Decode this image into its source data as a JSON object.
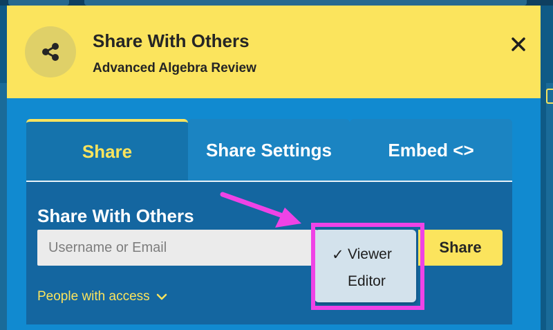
{
  "modal": {
    "title": "Share With Others",
    "subtitle": "Advanced Algebra Review",
    "header_icon": "share-icon",
    "close_icon": "close-icon"
  },
  "tabs": [
    {
      "label": "Share",
      "active": true
    },
    {
      "label": "Share Settings",
      "active": false
    },
    {
      "label": "Embed <>",
      "active": false
    }
  ],
  "panel": {
    "title": "Share With Others",
    "input_placeholder": "Username or Email",
    "share_button": "Share",
    "people_access": "People with access"
  },
  "role_dropdown": {
    "options": [
      {
        "label": "Viewer",
        "selected": true,
        "check": "✓"
      },
      {
        "label": "Editor",
        "selected": false,
        "check": ""
      }
    ]
  },
  "colors": {
    "header": "#fbe45d",
    "modal_bg": "#118ad0",
    "panel": "#1466a0",
    "accent_yellow": "#fbe45d",
    "annotation": "#ef43e6"
  }
}
